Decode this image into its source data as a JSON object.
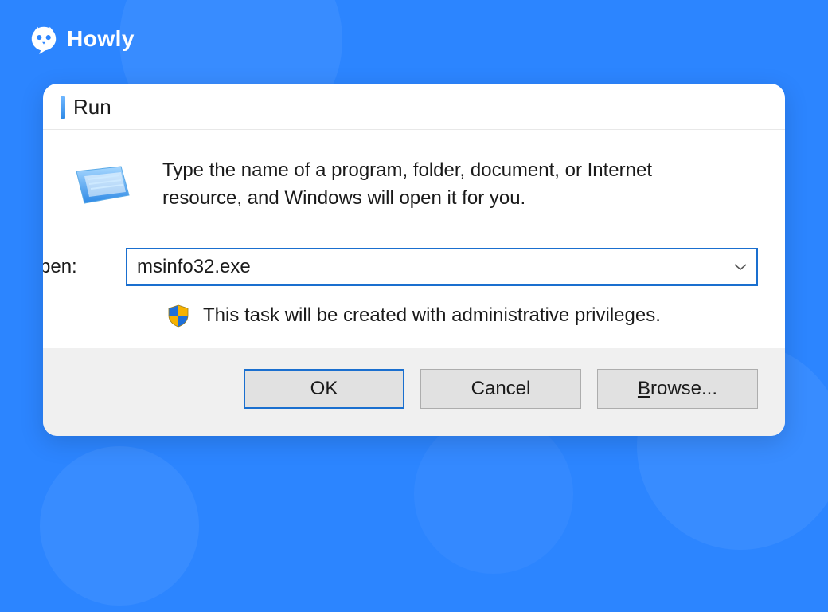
{
  "brand": {
    "name": "Howly",
    "icon": "owl-icon"
  },
  "dialog": {
    "title": "Run",
    "instruction": "Type the name of a program, folder, document, or Internet resource, and Windows will open it for you.",
    "open_label": "Open:",
    "open_value": "msinfo32.exe",
    "admin_note": "This task will be created with administrative privileges.",
    "buttons": {
      "ok": "OK",
      "cancel": "Cancel",
      "browse_prefix": "B",
      "browse_rest": "rowse..."
    }
  }
}
